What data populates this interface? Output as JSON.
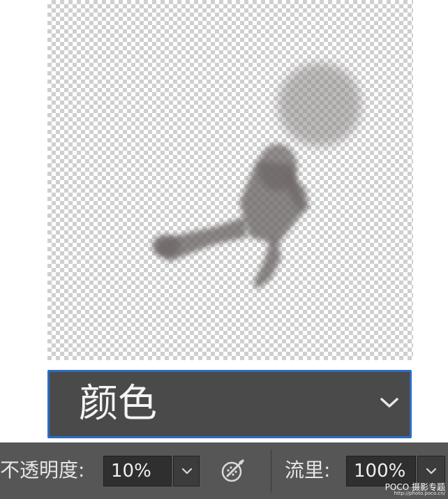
{
  "blend_mode": {
    "selected": "颜色",
    "icon": "chevron-down-icon"
  },
  "options_bar": {
    "opacity_label": "不透明度:",
    "opacity_value": "10%",
    "airbrush_icon": "airbrush-icon",
    "flow_label": "流里:",
    "flow_value": "100%"
  },
  "watermark": {
    "brand": "POCO",
    "tag": "摄影专题",
    "url": "http://photo.poco.cn/"
  },
  "colors": {
    "dropdown_bg": "#4a4a4a",
    "dropdown_border": "#2b6cc4",
    "toolbar_bg": "#565656",
    "field_bg": "#2f2f2f",
    "silhouette": "#6e6868"
  }
}
